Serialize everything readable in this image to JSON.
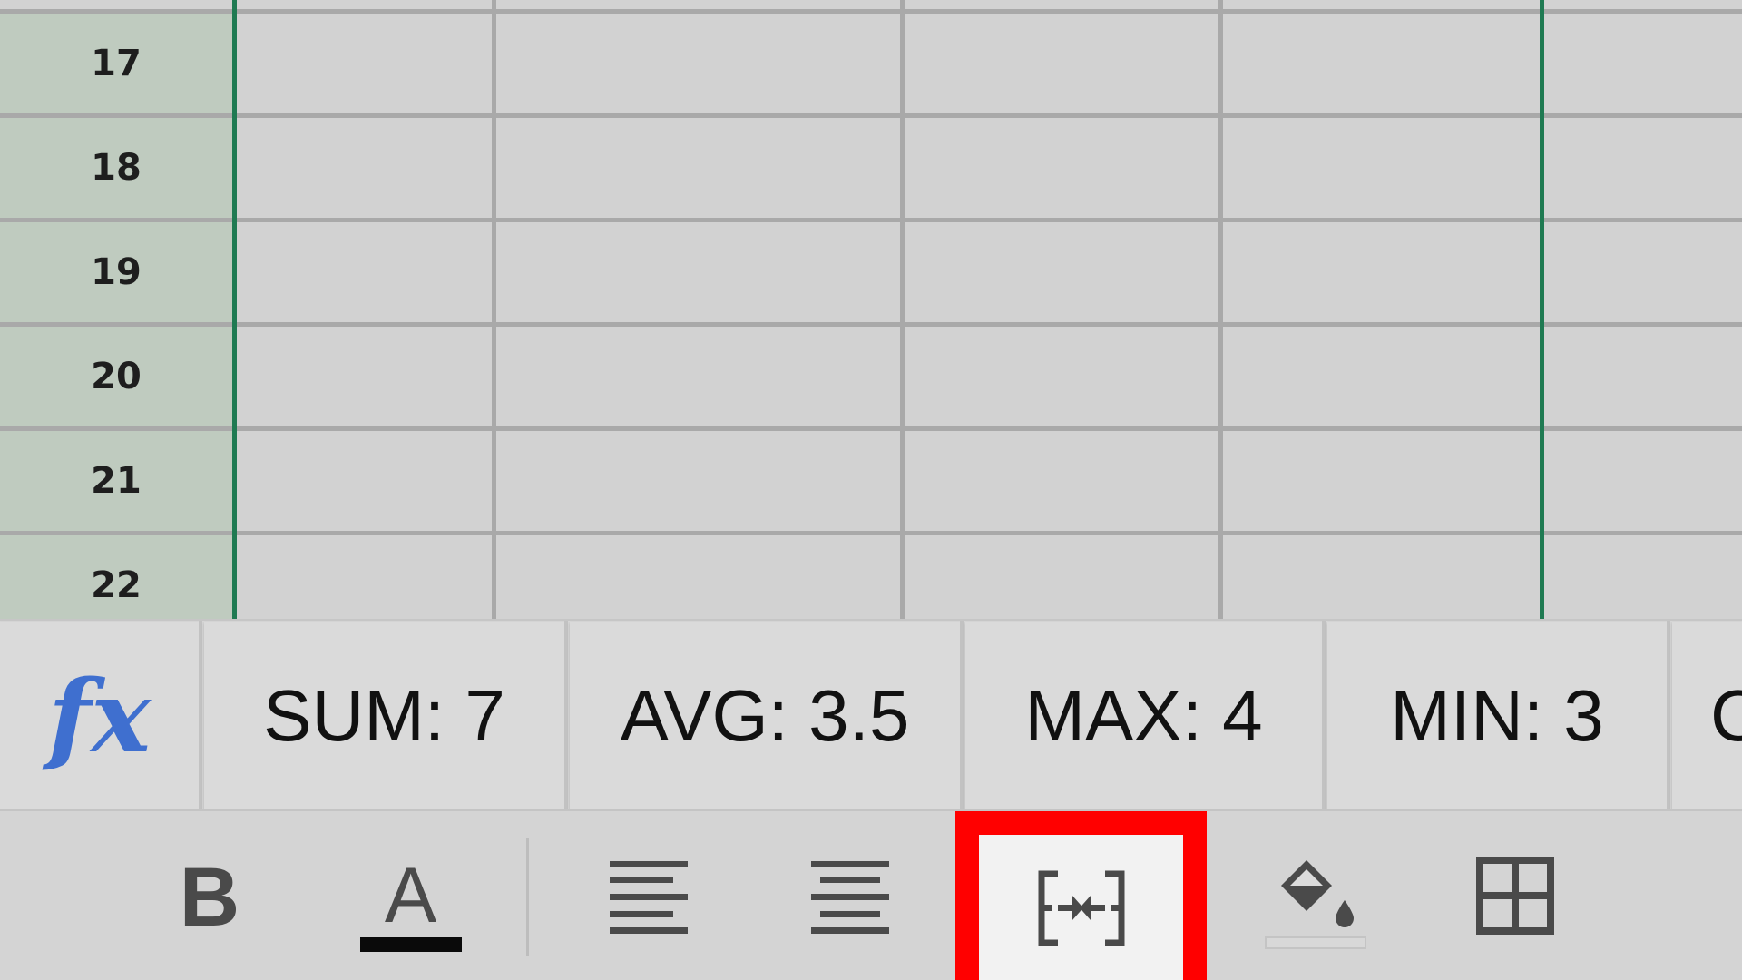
{
  "colors": {
    "grid_background": "#d2d2d2",
    "grid_line": "#a9a9a9",
    "row_header_background": "#bfcbbf",
    "selection_border": "#1f7a52",
    "fx_color": "#3f6fcf",
    "highlight": "#ff0000",
    "icon_color": "#4a4a4a"
  },
  "grid": {
    "rows": [
      {
        "label": "17"
      },
      {
        "label": "18"
      },
      {
        "label": "19"
      },
      {
        "label": "20"
      },
      {
        "label": "21"
      },
      {
        "label": "22"
      }
    ]
  },
  "stats": {
    "fx_label": "fx",
    "sum": "SUM: 7",
    "avg": "AVG: 3.5",
    "max": "MAX: 4",
    "min": "MIN: 3",
    "next_partial": "C"
  },
  "toolbar": {
    "bold_label": "B",
    "font_color_label": "A",
    "icons": [
      "bold-icon",
      "font-color-icon",
      "align-left-icon",
      "align-center-icon",
      "merge-cells-icon",
      "fill-color-icon",
      "borders-icon"
    ],
    "highlighted_tool": "merge-cells"
  }
}
